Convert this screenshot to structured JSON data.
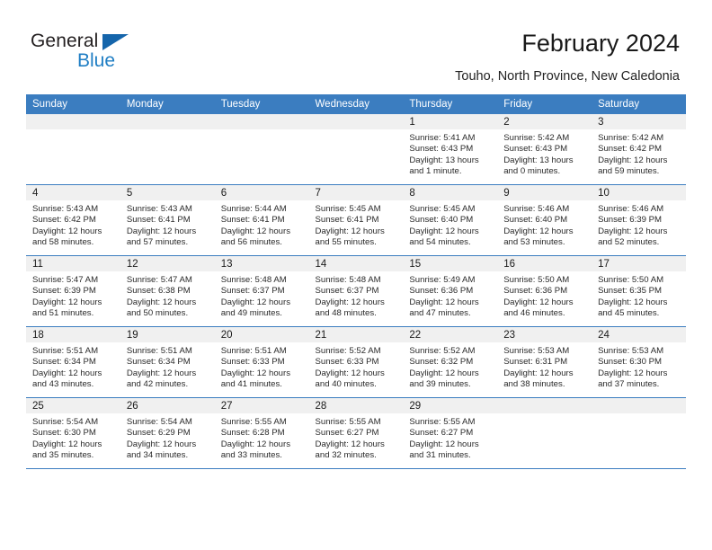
{
  "logo": {
    "word1": "General",
    "word2": "Blue",
    "triangle_color": "#1565ab",
    "blue_color": "#1f7ec4"
  },
  "header": {
    "title": "February 2024",
    "subtitle": "Touho, North Province, New Caledonia",
    "header_bg": "#3b7dc0"
  },
  "weekday_headers": [
    "Sunday",
    "Monday",
    "Tuesday",
    "Wednesday",
    "Thursday",
    "Friday",
    "Saturday"
  ],
  "labels": {
    "sunrise": "Sunrise:",
    "sunset": "Sunset:",
    "daylight": "Daylight:"
  },
  "weeks": [
    [
      {
        "day": "",
        "sunrise": "",
        "sunset": "",
        "daylight_1": "",
        "daylight_2": ""
      },
      {
        "day": "",
        "sunrise": "",
        "sunset": "",
        "daylight_1": "",
        "daylight_2": ""
      },
      {
        "day": "",
        "sunrise": "",
        "sunset": "",
        "daylight_1": "",
        "daylight_2": ""
      },
      {
        "day": "",
        "sunrise": "",
        "sunset": "",
        "daylight_1": "",
        "daylight_2": ""
      },
      {
        "day": "1",
        "sunrise": "Sunrise: 5:41 AM",
        "sunset": "Sunset: 6:43 PM",
        "daylight_1": "Daylight: 13 hours",
        "daylight_2": "and 1 minute."
      },
      {
        "day": "2",
        "sunrise": "Sunrise: 5:42 AM",
        "sunset": "Sunset: 6:43 PM",
        "daylight_1": "Daylight: 13 hours",
        "daylight_2": "and 0 minutes."
      },
      {
        "day": "3",
        "sunrise": "Sunrise: 5:42 AM",
        "sunset": "Sunset: 6:42 PM",
        "daylight_1": "Daylight: 12 hours",
        "daylight_2": "and 59 minutes."
      }
    ],
    [
      {
        "day": "4",
        "sunrise": "Sunrise: 5:43 AM",
        "sunset": "Sunset: 6:42 PM",
        "daylight_1": "Daylight: 12 hours",
        "daylight_2": "and 58 minutes."
      },
      {
        "day": "5",
        "sunrise": "Sunrise: 5:43 AM",
        "sunset": "Sunset: 6:41 PM",
        "daylight_1": "Daylight: 12 hours",
        "daylight_2": "and 57 minutes."
      },
      {
        "day": "6",
        "sunrise": "Sunrise: 5:44 AM",
        "sunset": "Sunset: 6:41 PM",
        "daylight_1": "Daylight: 12 hours",
        "daylight_2": "and 56 minutes."
      },
      {
        "day": "7",
        "sunrise": "Sunrise: 5:45 AM",
        "sunset": "Sunset: 6:41 PM",
        "daylight_1": "Daylight: 12 hours",
        "daylight_2": "and 55 minutes."
      },
      {
        "day": "8",
        "sunrise": "Sunrise: 5:45 AM",
        "sunset": "Sunset: 6:40 PM",
        "daylight_1": "Daylight: 12 hours",
        "daylight_2": "and 54 minutes."
      },
      {
        "day": "9",
        "sunrise": "Sunrise: 5:46 AM",
        "sunset": "Sunset: 6:40 PM",
        "daylight_1": "Daylight: 12 hours",
        "daylight_2": "and 53 minutes."
      },
      {
        "day": "10",
        "sunrise": "Sunrise: 5:46 AM",
        "sunset": "Sunset: 6:39 PM",
        "daylight_1": "Daylight: 12 hours",
        "daylight_2": "and 52 minutes."
      }
    ],
    [
      {
        "day": "11",
        "sunrise": "Sunrise: 5:47 AM",
        "sunset": "Sunset: 6:39 PM",
        "daylight_1": "Daylight: 12 hours",
        "daylight_2": "and 51 minutes."
      },
      {
        "day": "12",
        "sunrise": "Sunrise: 5:47 AM",
        "sunset": "Sunset: 6:38 PM",
        "daylight_1": "Daylight: 12 hours",
        "daylight_2": "and 50 minutes."
      },
      {
        "day": "13",
        "sunrise": "Sunrise: 5:48 AM",
        "sunset": "Sunset: 6:37 PM",
        "daylight_1": "Daylight: 12 hours",
        "daylight_2": "and 49 minutes."
      },
      {
        "day": "14",
        "sunrise": "Sunrise: 5:48 AM",
        "sunset": "Sunset: 6:37 PM",
        "daylight_1": "Daylight: 12 hours",
        "daylight_2": "and 48 minutes."
      },
      {
        "day": "15",
        "sunrise": "Sunrise: 5:49 AM",
        "sunset": "Sunset: 6:36 PM",
        "daylight_1": "Daylight: 12 hours",
        "daylight_2": "and 47 minutes."
      },
      {
        "day": "16",
        "sunrise": "Sunrise: 5:50 AM",
        "sunset": "Sunset: 6:36 PM",
        "daylight_1": "Daylight: 12 hours",
        "daylight_2": "and 46 minutes."
      },
      {
        "day": "17",
        "sunrise": "Sunrise: 5:50 AM",
        "sunset": "Sunset: 6:35 PM",
        "daylight_1": "Daylight: 12 hours",
        "daylight_2": "and 45 minutes."
      }
    ],
    [
      {
        "day": "18",
        "sunrise": "Sunrise: 5:51 AM",
        "sunset": "Sunset: 6:34 PM",
        "daylight_1": "Daylight: 12 hours",
        "daylight_2": "and 43 minutes."
      },
      {
        "day": "19",
        "sunrise": "Sunrise: 5:51 AM",
        "sunset": "Sunset: 6:34 PM",
        "daylight_1": "Daylight: 12 hours",
        "daylight_2": "and 42 minutes."
      },
      {
        "day": "20",
        "sunrise": "Sunrise: 5:51 AM",
        "sunset": "Sunset: 6:33 PM",
        "daylight_1": "Daylight: 12 hours",
        "daylight_2": "and 41 minutes."
      },
      {
        "day": "21",
        "sunrise": "Sunrise: 5:52 AM",
        "sunset": "Sunset: 6:33 PM",
        "daylight_1": "Daylight: 12 hours",
        "daylight_2": "and 40 minutes."
      },
      {
        "day": "22",
        "sunrise": "Sunrise: 5:52 AM",
        "sunset": "Sunset: 6:32 PM",
        "daylight_1": "Daylight: 12 hours",
        "daylight_2": "and 39 minutes."
      },
      {
        "day": "23",
        "sunrise": "Sunrise: 5:53 AM",
        "sunset": "Sunset: 6:31 PM",
        "daylight_1": "Daylight: 12 hours",
        "daylight_2": "and 38 minutes."
      },
      {
        "day": "24",
        "sunrise": "Sunrise: 5:53 AM",
        "sunset": "Sunset: 6:30 PM",
        "daylight_1": "Daylight: 12 hours",
        "daylight_2": "and 37 minutes."
      }
    ],
    [
      {
        "day": "25",
        "sunrise": "Sunrise: 5:54 AM",
        "sunset": "Sunset: 6:30 PM",
        "daylight_1": "Daylight: 12 hours",
        "daylight_2": "and 35 minutes."
      },
      {
        "day": "26",
        "sunrise": "Sunrise: 5:54 AM",
        "sunset": "Sunset: 6:29 PM",
        "daylight_1": "Daylight: 12 hours",
        "daylight_2": "and 34 minutes."
      },
      {
        "day": "27",
        "sunrise": "Sunrise: 5:55 AM",
        "sunset": "Sunset: 6:28 PM",
        "daylight_1": "Daylight: 12 hours",
        "daylight_2": "and 33 minutes."
      },
      {
        "day": "28",
        "sunrise": "Sunrise: 5:55 AM",
        "sunset": "Sunset: 6:27 PM",
        "daylight_1": "Daylight: 12 hours",
        "daylight_2": "and 32 minutes."
      },
      {
        "day": "29",
        "sunrise": "Sunrise: 5:55 AM",
        "sunset": "Sunset: 6:27 PM",
        "daylight_1": "Daylight: 12 hours",
        "daylight_2": "and 31 minutes."
      },
      {
        "day": "",
        "sunrise": "",
        "sunset": "",
        "daylight_1": "",
        "daylight_2": ""
      },
      {
        "day": "",
        "sunrise": "",
        "sunset": "",
        "daylight_1": "",
        "daylight_2": ""
      }
    ]
  ]
}
